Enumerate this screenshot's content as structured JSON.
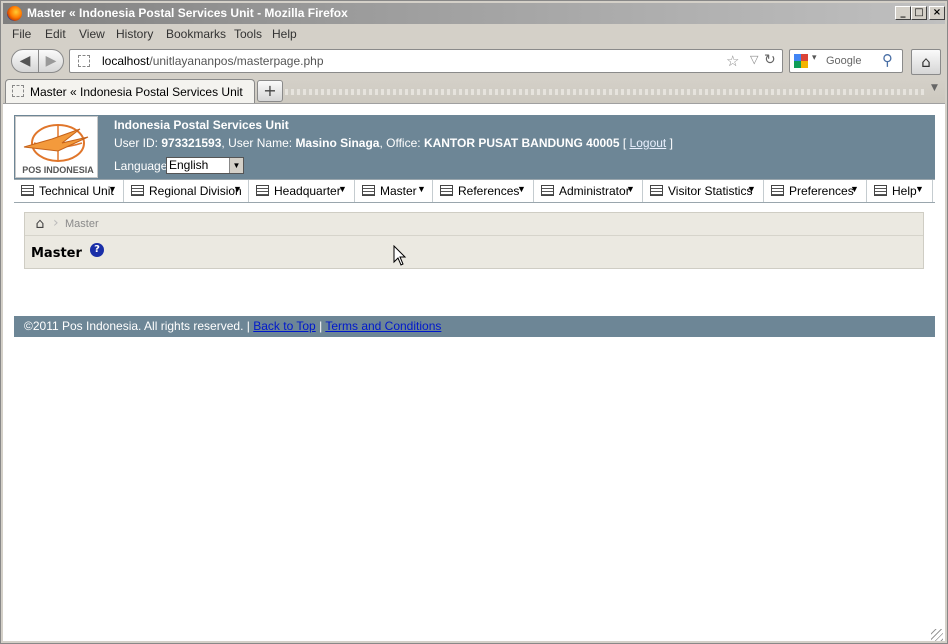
{
  "browser": {
    "window_title": "Master « Indonesia Postal Services Unit - Mozilla Firefox",
    "menu": [
      "File",
      "Edit",
      "View",
      "History",
      "Bookmarks",
      "Tools",
      "Help"
    ],
    "url_host": "localhost",
    "url_path": "/unitlayananpos/masterpage.php",
    "search_placeholder": "Google",
    "tab_title": "Master « Indonesia Postal Services Unit",
    "new_tab_label": "+"
  },
  "header": {
    "logo_text": "POS INDONESIA",
    "site_title": "Indonesia Postal Services Unit",
    "user_id_label": "User ID: ",
    "user_id": "973321593",
    "user_name_label": ", User Name: ",
    "user_name": "Masino Sinaga",
    "office_label": ", Office: ",
    "office": "KANTOR PUSAT BANDUNG 40005",
    "bracket_open": " [ ",
    "logout": "Logout",
    "bracket_close": " ]",
    "language_label": "Language",
    "language_value": "English"
  },
  "nav": [
    {
      "label": "Technical Unit",
      "icon": "list-icon"
    },
    {
      "label": "Regional Division",
      "icon": "list-icon"
    },
    {
      "label": "Headquarter",
      "icon": "list-icon"
    },
    {
      "label": "Master",
      "icon": "list-icon"
    },
    {
      "label": "References",
      "icon": "doc-gear-icon"
    },
    {
      "label": "Administrator",
      "icon": "doc-gear-icon"
    },
    {
      "label": "Visitor Statistics",
      "icon": "chart-icon"
    },
    {
      "label": "Preferences",
      "icon": "wrench-icon"
    },
    {
      "label": "Help",
      "icon": "book-icon"
    }
  ],
  "breadcrumb": {
    "current": "Master"
  },
  "page": {
    "title": "Master",
    "help": "?"
  },
  "footer": {
    "copyright": "©2011 Pos Indonesia. All rights reserved.",
    "back_to_top": "Back to Top",
    "terms": "Terms and Conditions"
  },
  "colors": {
    "header_bg": "#6d8696",
    "panel_bg": "#ebe9e1",
    "link": "#0018cc"
  }
}
